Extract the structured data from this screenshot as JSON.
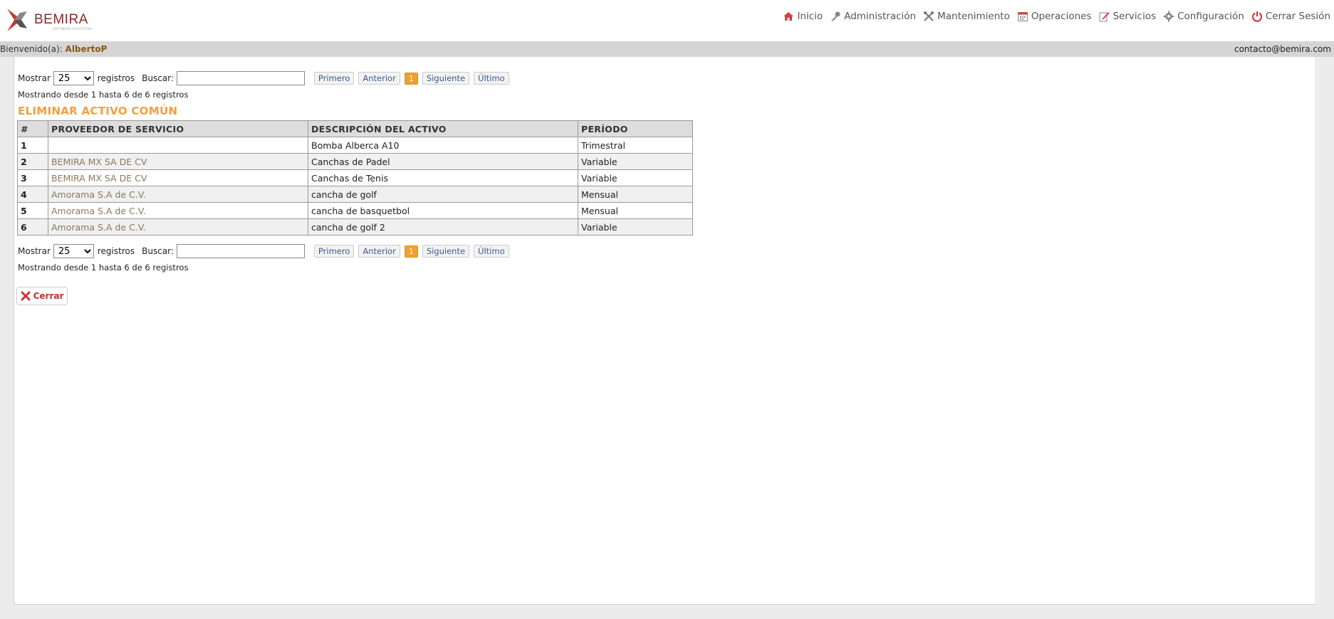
{
  "brand": {
    "name": "BEMIRA",
    "tagline": "SOFTWARE SOLUTIONS"
  },
  "nav": [
    {
      "label": "Inicio",
      "icon": "home-icon"
    },
    {
      "label": "Administración",
      "icon": "key-icon"
    },
    {
      "label": "Mantenimiento",
      "icon": "tools-icon"
    },
    {
      "label": "Operaciones",
      "icon": "calendar-icon"
    },
    {
      "label": "Servicios",
      "icon": "edit-icon"
    },
    {
      "label": "Configuración",
      "icon": "gear-icon"
    },
    {
      "label": "Cerrar Sesión",
      "icon": "power-icon"
    }
  ],
  "welcome": {
    "prefix": "Bienvenido(a):",
    "user": "AlbertoP",
    "contact": "contacto@bemira.com"
  },
  "controls": {
    "show_label": "Mostrar",
    "page_size": "25",
    "records_label": "registros",
    "search_label": "Buscar:",
    "search_value": "",
    "pager": {
      "first": "Primero",
      "prev": "Anterior",
      "current": "1",
      "next": "Siguiente",
      "last": "Último"
    },
    "info": "Mostrando desde 1 hasta 6 de 6 registros"
  },
  "title": "ELIMINAR ACTIVO COMÚN",
  "table": {
    "headers": [
      "#",
      "PROVEEDOR DE SERVICIO",
      "DESCRIPCIÓN DEL ACTIVO",
      "PERÍODO"
    ],
    "rows": [
      {
        "n": "1",
        "provider": "",
        "description": "Bomba Alberca A10",
        "period": "Trimestral"
      },
      {
        "n": "2",
        "provider": "BEMIRA MX SA DE CV",
        "description": "Canchas de Padel",
        "period": "Variable"
      },
      {
        "n": "3",
        "provider": "BEMIRA MX SA DE CV",
        "description": "Canchas de Tenis",
        "period": "Variable"
      },
      {
        "n": "4",
        "provider": "Amorama S.A de C.V.",
        "description": "cancha de golf",
        "period": "Mensual"
      },
      {
        "n": "5",
        "provider": "Amorama S.A de C.V.",
        "description": "cancha de basquetbol",
        "period": "Mensual"
      },
      {
        "n": "6",
        "provider": "Amorama S.A de C.V.",
        "description": "cancha de golf 2",
        "period": "Variable"
      }
    ]
  },
  "close_button": {
    "label": "Cerrar"
  }
}
